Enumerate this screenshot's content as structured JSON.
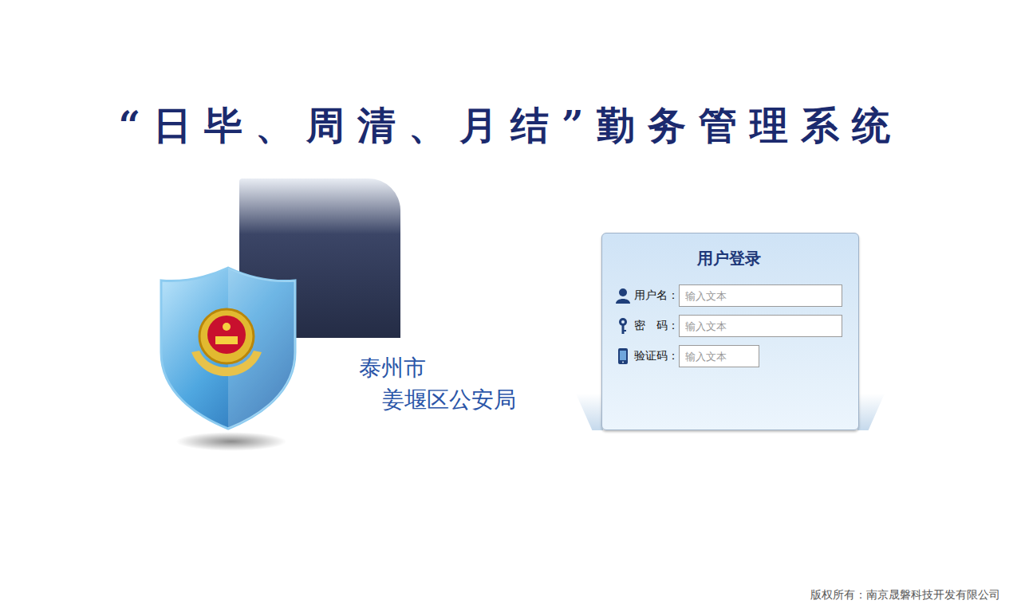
{
  "title": "“日毕、周清、月结”勤务管理系统",
  "agency": {
    "city": "泰州市",
    "bureau": "姜堰区公安局"
  },
  "login": {
    "heading": "用户登录",
    "fields": [
      {
        "label": "用户名：",
        "placeholder": "输入文本",
        "kind": "user"
      },
      {
        "label": "密　码：",
        "placeholder": "输入文本",
        "kind": "password"
      },
      {
        "label": "验证码：",
        "placeholder": "输入文本",
        "kind": "captcha"
      }
    ]
  },
  "footer": "版权所有：南京晟磐科技开发有限公司"
}
